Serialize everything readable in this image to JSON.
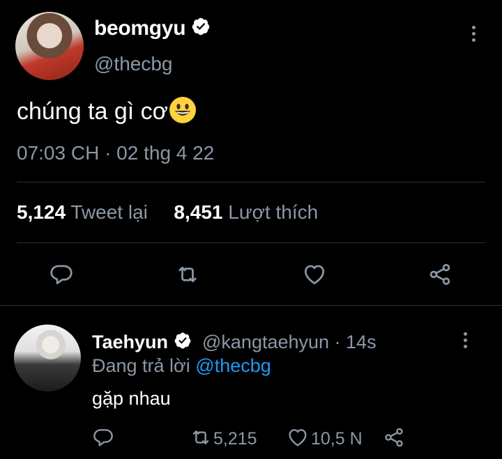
{
  "tweet": {
    "display_name": "beomgyu",
    "handle": "@thecbg",
    "text": "chúng ta gì cơ",
    "emoji": "grinning-face",
    "timestamp": "07:03 CH · 02 thg 4 22",
    "retweets": "5,124",
    "retweets_label": "Tweet lại",
    "likes": "8,451",
    "likes_label": "Lượt thích"
  },
  "reply": {
    "display_name": "Taehyun",
    "meta": "@kangtaehyun · 14s",
    "replying_prefix": "Đang trả lời",
    "replying_to": "@thecbg",
    "text": "gặp nhau",
    "retweet_count": "5,215",
    "like_count": "10,5 N"
  },
  "colors": {
    "background": "#000000",
    "text": "#ffffff",
    "muted": "#8b98a5",
    "accent": "#1d9bf0",
    "divider": "#2f3336"
  },
  "icons": [
    "verified-badge-icon",
    "more-vertical-icon",
    "reply-icon",
    "retweet-icon",
    "like-icon",
    "share-icon",
    "grinning-face-emoji"
  ]
}
